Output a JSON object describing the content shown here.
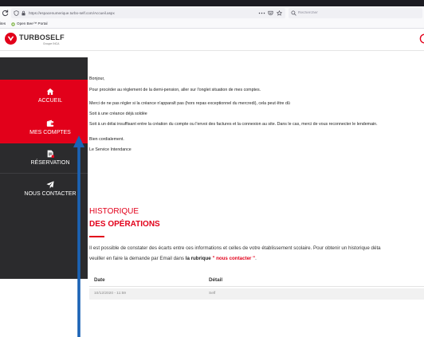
{
  "browser": {
    "url": "https://espacenumerique.turbo-self.com/Accueil.aspx",
    "search_placeholder": "Rechercher"
  },
  "bookmarks": {
    "partial_label": "ites",
    "items": [
      {
        "label": "Open Bee™ Portal"
      }
    ]
  },
  "app": {
    "brand": "TURBOSELF",
    "brand_sub": "Groupe INCA"
  },
  "sidebar": {
    "items": [
      {
        "label": "ACCUEIL",
        "icon": "home-icon"
      },
      {
        "label": "MES COMPTES",
        "icon": "card-icon"
      },
      {
        "label": "RÉSERVATION",
        "icon": "document-icon"
      },
      {
        "label": "NOUS CONTACTER",
        "icon": "send-icon"
      }
    ]
  },
  "message": {
    "greeting": "Bonjour,",
    "lines": [
      "Pour procéder au règlement de la demi-pension, aller sur l'onglet situation de mes comptes.",
      "Merci de ne pas régler si la créance n'apparaît pas (hors repas exceptionnel du mercredi), cela peut être dû",
      "Soit à une créance déjà soldée",
      "Soit à un délai insuffisant entre la création du compte ou l'envoi des factures et la connexion au site. Dans le cas, merci de vous reconnecter le lendemain."
    ],
    "closing": "Bien cordialement.",
    "signature": "Le Service Intendance"
  },
  "history": {
    "title_light": "HISTORIQUE",
    "title_bold": "DES OPÉRATIONS",
    "intro": "Il est possible de constater des écarts entre ces informations et celles de votre établissement scolaire. Pour obtenir un historique déta",
    "request_prefix": "veuiller en faire la demande par Email dans ",
    "request_bold": "la rubrique ",
    "request_link": "\" nous contacter \"",
    "request_suffix": ".",
    "columns": [
      "Date",
      "Détail"
    ],
    "rows": [
      {
        "date": "10/12/2020 - 11:59",
        "detail": "Self"
      }
    ]
  },
  "colors": {
    "accent": "#e2001a",
    "sidebar": "#2b2b2d",
    "annotation_arrow": "#1b63b5",
    "browser_tabstrip": "#1c1b22"
  }
}
